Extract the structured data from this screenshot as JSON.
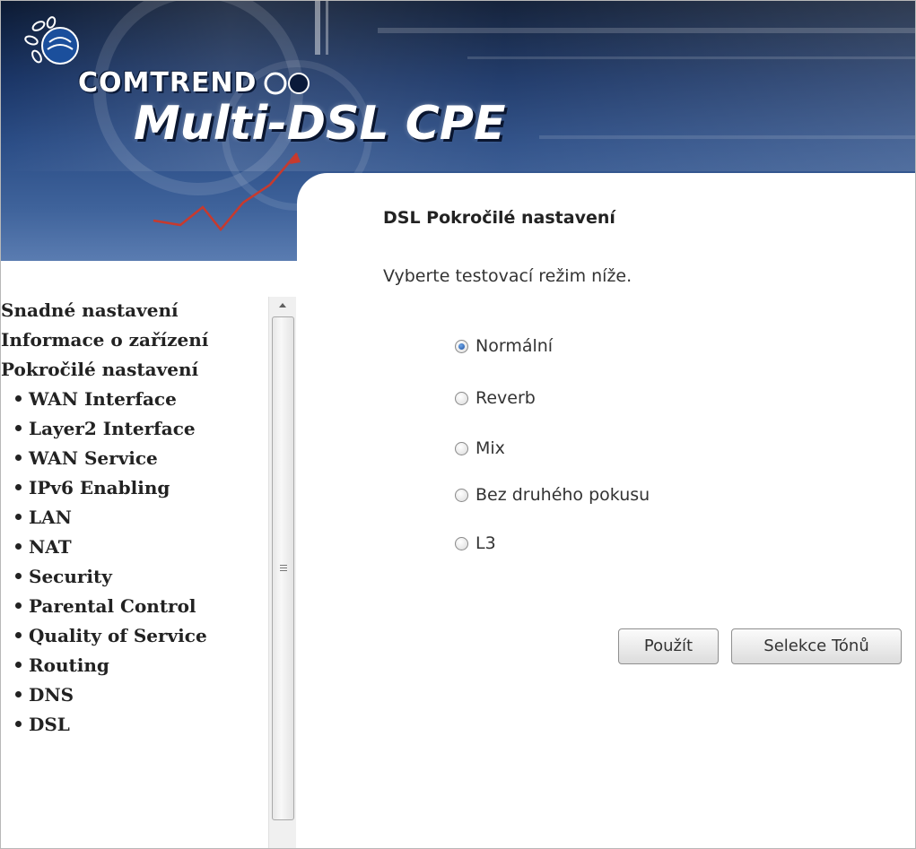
{
  "header": {
    "brand": "COMTREND",
    "product": "Multi-DSL CPE"
  },
  "sidebar": {
    "items": [
      {
        "label": "Snadné nastavení",
        "level": 0
      },
      {
        "label": "Informace o zařízení",
        "level": 0
      },
      {
        "label": "Pokročilé nastavení",
        "level": 0
      },
      {
        "label": "WAN Interface",
        "level": 1
      },
      {
        "label": "Layer2 Interface",
        "level": 1
      },
      {
        "label": "WAN Service",
        "level": 1
      },
      {
        "label": "IPv6 Enabling",
        "level": 1
      },
      {
        "label": "LAN",
        "level": 1
      },
      {
        "label": "NAT",
        "level": 1
      },
      {
        "label": "Security",
        "level": 1
      },
      {
        "label": "Parental Control",
        "level": 1
      },
      {
        "label": "Quality of Service",
        "level": 1
      },
      {
        "label": "Routing",
        "level": 1
      },
      {
        "label": "DNS",
        "level": 1
      },
      {
        "label": "DSL",
        "level": 1
      }
    ]
  },
  "main": {
    "title": "DSL Pokročilé nastavení",
    "description": "Vyberte testovací režim níže.",
    "options": [
      {
        "label": "Normální",
        "checked": true
      },
      {
        "label": "Reverb",
        "checked": false
      },
      {
        "label": "Mix",
        "checked": false
      },
      {
        "label": "Bez druhého pokusu",
        "checked": false
      },
      {
        "label": "L3",
        "checked": false
      }
    ],
    "apply_label": "Použít",
    "tones_label": "Selekce Tónů"
  }
}
